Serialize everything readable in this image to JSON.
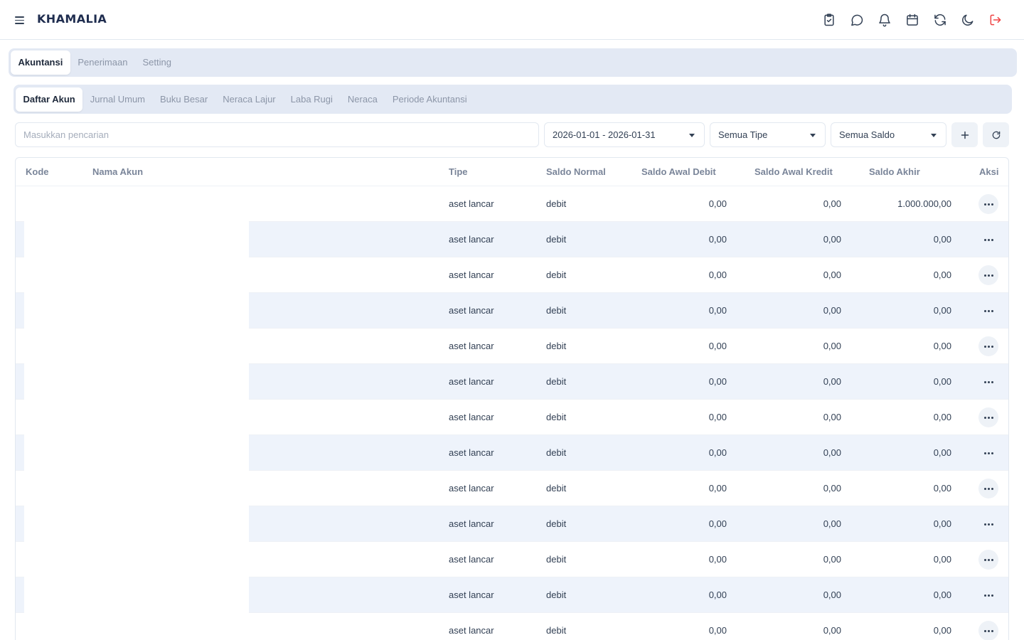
{
  "app": {
    "brand": "KHAMALIA"
  },
  "header_icons": [
    "clipboard-check-icon",
    "chat-bubble-icon",
    "bell-icon",
    "calendar-icon",
    "refresh-icon",
    "moon-icon",
    "logout-icon"
  ],
  "main_tabs": [
    {
      "label": "Akuntansi",
      "active": true
    },
    {
      "label": "Penerimaan",
      "active": false
    },
    {
      "label": "Setting",
      "active": false
    }
  ],
  "sub_tabs": [
    {
      "label": "Daftar Akun",
      "active": true
    },
    {
      "label": "Jurnal Umum",
      "active": false
    },
    {
      "label": "Buku Besar",
      "active": false
    },
    {
      "label": "Neraca Lajur",
      "active": false
    },
    {
      "label": "Laba Rugi",
      "active": false
    },
    {
      "label": "Neraca",
      "active": false
    },
    {
      "label": "Periode Akuntansi",
      "active": false
    }
  ],
  "filters": {
    "search_placeholder": "Masukkan pencarian",
    "date_range": "2026-01-01 - 2026-01-31",
    "type": "Semua Tipe",
    "saldo": "Semua Saldo"
  },
  "table": {
    "columns": [
      "Kode",
      "Nama Akun",
      "Tipe",
      "Saldo Normal",
      "Saldo Awal Debit",
      "Saldo Awal Kredit",
      "Saldo Akhir",
      "Aksi"
    ],
    "rows": [
      {
        "kode": "",
        "nama": "",
        "tipe": "aset lancar",
        "saldo_normal": "debit",
        "awal_debit": "0,00",
        "awal_kredit": "0,00",
        "akhir": "1.000.000,00"
      },
      {
        "kode": "",
        "nama": "",
        "tipe": "aset lancar",
        "saldo_normal": "debit",
        "awal_debit": "0,00",
        "awal_kredit": "0,00",
        "akhir": "0,00"
      },
      {
        "kode": "",
        "nama": "",
        "tipe": "aset lancar",
        "saldo_normal": "debit",
        "awal_debit": "0,00",
        "awal_kredit": "0,00",
        "akhir": "0,00"
      },
      {
        "kode": "",
        "nama": "",
        "tipe": "aset lancar",
        "saldo_normal": "debit",
        "awal_debit": "0,00",
        "awal_kredit": "0,00",
        "akhir": "0,00"
      },
      {
        "kode": "",
        "nama": "",
        "tipe": "aset lancar",
        "saldo_normal": "debit",
        "awal_debit": "0,00",
        "awal_kredit": "0,00",
        "akhir": "0,00"
      },
      {
        "kode": "",
        "nama": "",
        "tipe": "aset lancar",
        "saldo_normal": "debit",
        "awal_debit": "0,00",
        "awal_kredit": "0,00",
        "akhir": "0,00"
      },
      {
        "kode": "",
        "nama": "",
        "tipe": "aset lancar",
        "saldo_normal": "debit",
        "awal_debit": "0,00",
        "awal_kredit": "0,00",
        "akhir": "0,00"
      },
      {
        "kode": "",
        "nama": "",
        "tipe": "aset lancar",
        "saldo_normal": "debit",
        "awal_debit": "0,00",
        "awal_kredit": "0,00",
        "akhir": "0,00"
      },
      {
        "kode": "",
        "nama": "",
        "tipe": "aset lancar",
        "saldo_normal": "debit",
        "awal_debit": "0,00",
        "awal_kredit": "0,00",
        "akhir": "0,00"
      },
      {
        "kode": "",
        "nama": "",
        "tipe": "aset lancar",
        "saldo_normal": "debit",
        "awal_debit": "0,00",
        "awal_kredit": "0,00",
        "akhir": "0,00"
      },
      {
        "kode": "",
        "nama": "",
        "tipe": "aset lancar",
        "saldo_normal": "debit",
        "awal_debit": "0,00",
        "awal_kredit": "0,00",
        "akhir": "0,00"
      },
      {
        "kode": "",
        "nama": "",
        "tipe": "aset lancar",
        "saldo_normal": "debit",
        "awal_debit": "0,00",
        "awal_kredit": "0,00",
        "akhir": "0,00"
      },
      {
        "kode": "",
        "nama": "",
        "tipe": "aset lancar",
        "saldo_normal": "debit",
        "awal_debit": "0,00",
        "awal_kredit": "0,00",
        "akhir": "0,00"
      }
    ]
  },
  "colors": {
    "accent_bg": "#e3e9f4",
    "row_alt": "#eef3fb",
    "logout": "#ef4444",
    "text": "#334155"
  }
}
